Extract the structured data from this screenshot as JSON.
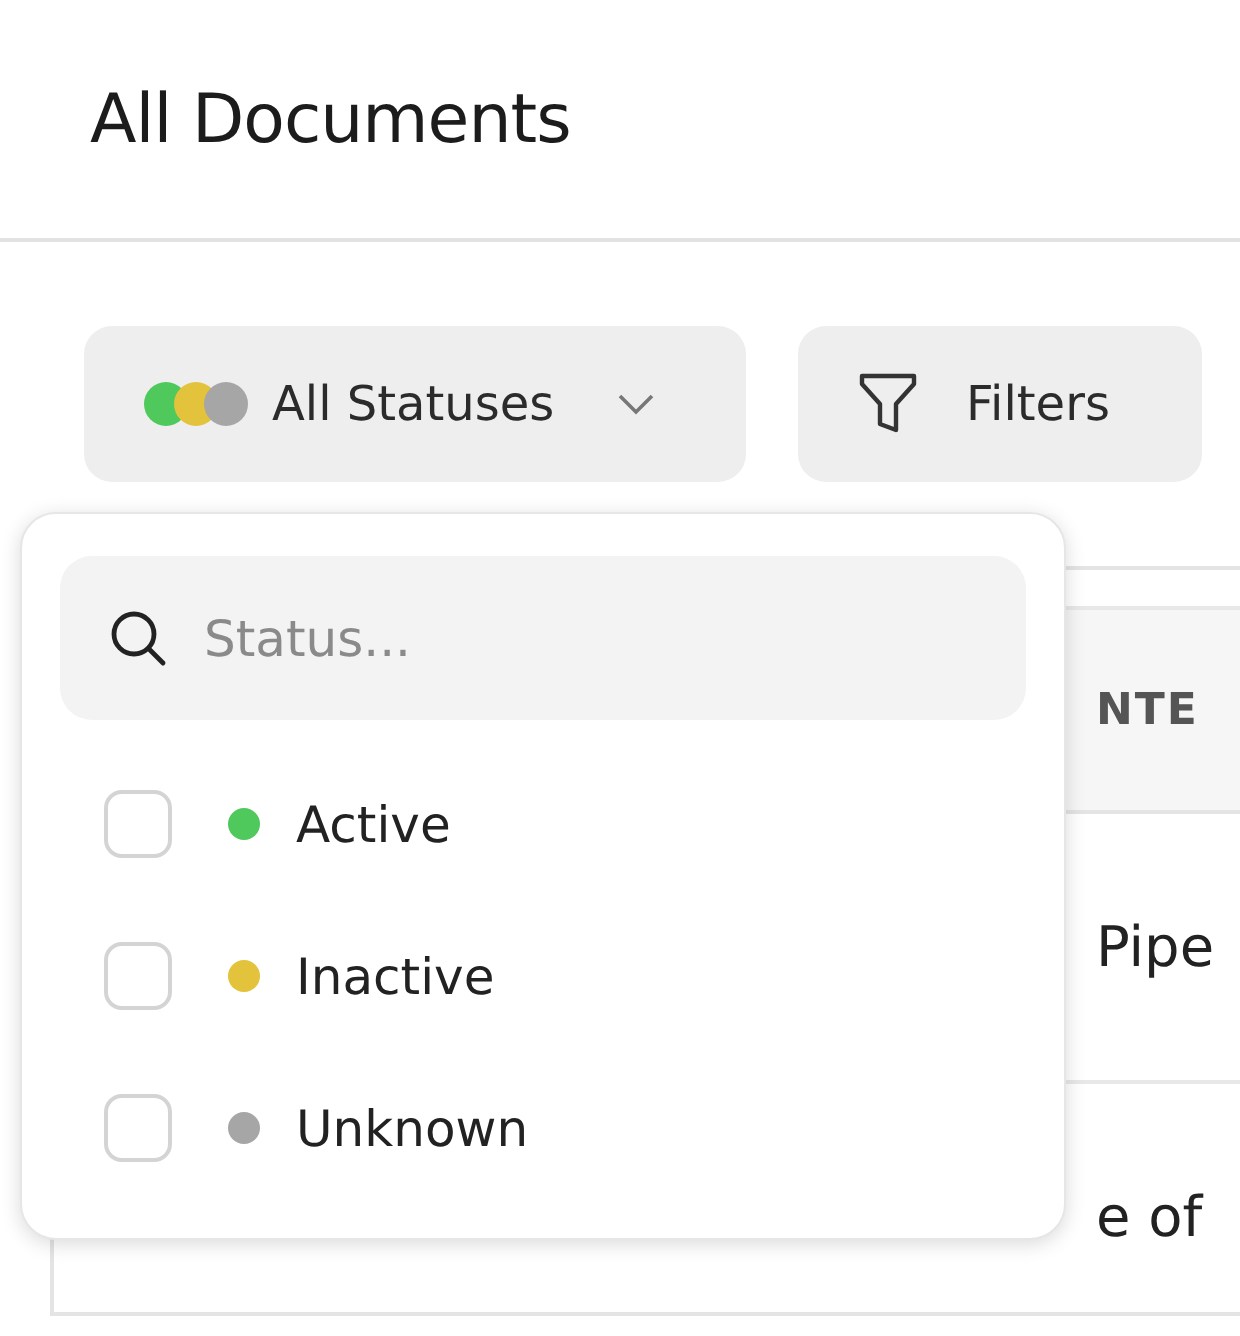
{
  "page": {
    "title": "All Documents"
  },
  "toolbar": {
    "status_button": {
      "label": "All Statuses",
      "dots": [
        {
          "color": "#4fc95c"
        },
        {
          "color": "#e3c23c"
        },
        {
          "color": "#a6a6a6"
        }
      ]
    },
    "filters_button": {
      "label": "Filters"
    }
  },
  "table": {
    "columns": [
      "NTE"
    ],
    "rows": [
      {
        "column_1": "Pipe"
      },
      {
        "column_1": "e of"
      }
    ]
  },
  "status_dropdown": {
    "search": {
      "placeholder": "Status..."
    },
    "options": [
      {
        "label": "Active",
        "color": "#4fc95c",
        "checked": false
      },
      {
        "label": "Inactive",
        "color": "#e3c23c",
        "checked": false
      },
      {
        "label": "Unknown",
        "color": "#a6a6a6",
        "checked": false
      }
    ]
  }
}
